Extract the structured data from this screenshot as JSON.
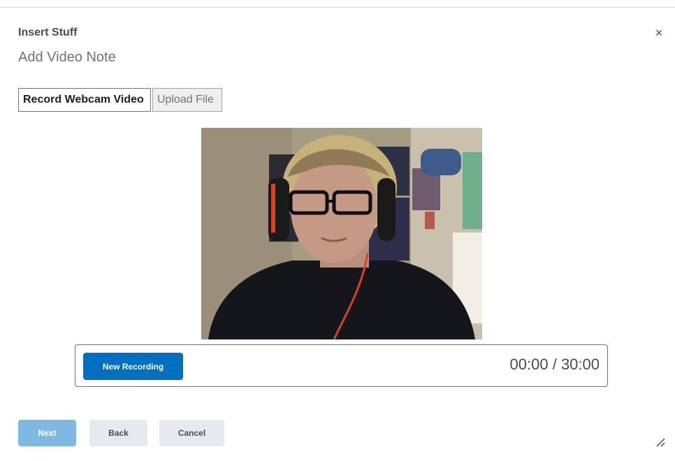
{
  "dialog": {
    "title": "Insert Stuff",
    "subtitle": "Add Video Note",
    "close_icon": "×",
    "close_icon_name": "close-icon"
  },
  "tabs": [
    {
      "label": "Record Webcam Video",
      "active": true
    },
    {
      "label": "Upload File",
      "active": false
    }
  ],
  "recorder": {
    "new_recording_label": "New Recording",
    "timer": "00:00 / 30:00"
  },
  "footer": {
    "next_label": "Next",
    "back_label": "Back",
    "cancel_label": "Cancel"
  },
  "colors": {
    "primary": "#006fbf",
    "primary_disabled": "#7fb8e1",
    "secondary_bg": "#e6eaf0",
    "text": "#494c4e"
  }
}
